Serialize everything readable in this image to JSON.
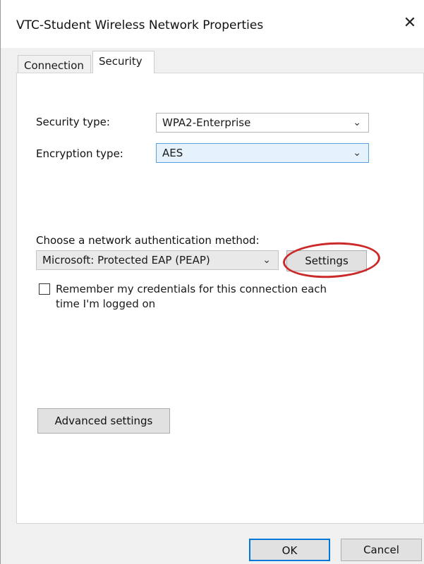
{
  "window": {
    "title": "VTC-Student Wireless Network Properties",
    "close_symbol": "✕"
  },
  "tabs": [
    {
      "label": "Connection",
      "active": false
    },
    {
      "label": "Security",
      "active": true
    }
  ],
  "security": {
    "security_type_label": "Security type:",
    "security_type_value": "WPA2-Enterprise",
    "encryption_type_label": "Encryption type:",
    "encryption_type_value": "AES",
    "auth_method_label": "Choose a network authentication method:",
    "auth_method_value": "Microsoft: Protected EAP (PEAP)",
    "settings_button": "Settings",
    "remember_credentials_label": "Remember my credentials for this connection each time I'm logged on",
    "remember_credentials_checked": false,
    "advanced_settings_button": "Advanced settings"
  },
  "footer": {
    "ok_button": "OK",
    "cancel_button": "Cancel"
  },
  "colors": {
    "highlight_circle": "#cc2a2a",
    "focus_border": "#5aa0e0"
  },
  "icons": {
    "close": "close-icon",
    "dropdown": "chevron-down-icon"
  }
}
